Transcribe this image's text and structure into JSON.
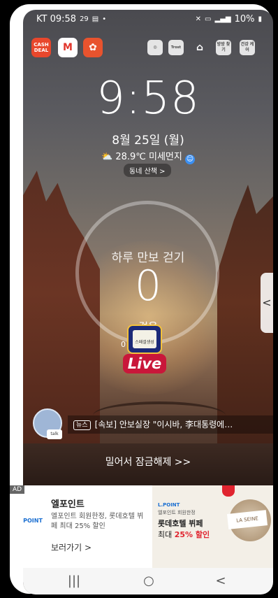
{
  "statusbar": {
    "carrier_time": "KT 09:58",
    "small_num": "29",
    "dot": "•",
    "battery": "10%"
  },
  "shortcuts": {
    "cash_label": "CASH DEAL",
    "trost_label": "Trost",
    "bangbang_label": "방방 찾기",
    "health_label": "건강 케어"
  },
  "lock": {
    "time": "9:58",
    "date": "8월 25일 (월)",
    "weather": "28.9℃ 미세먼지",
    "walk_pill": "동네 산책 >",
    "ring_title": "하루 만보 걷기",
    "ring_count": "0",
    "ring_unit": "걸음",
    "ring_extra": "0",
    "live_screen": "스페셜생성",
    "live_label": "Live",
    "handle_glyph": "<",
    "avatar_tag": "talk",
    "news_tag": "뉴스",
    "news_text": "[속보] 안보실장 \"이시바, 李대통령에…",
    "unlock": "밀어서 잠금해제 >>"
  },
  "ad": {
    "badge": "AD",
    "title": "엘포인트",
    "lpoint": "L.POINT",
    "desc": "엘포인트 회원한정, 롯데호텔 뷔페 최대 25% 할인",
    "cta": "보러가기 >",
    "right_lpoint": "L.POINT",
    "right_sub": "엘포인트 회원한정",
    "right_title": "롯데호텔 뷔페",
    "right_off_prefix": "최대",
    "right_off_value": "25% 할인",
    "card_text": "LA SEINE"
  },
  "navbar": {
    "recents": "|||",
    "home": "○",
    "back": "<"
  }
}
